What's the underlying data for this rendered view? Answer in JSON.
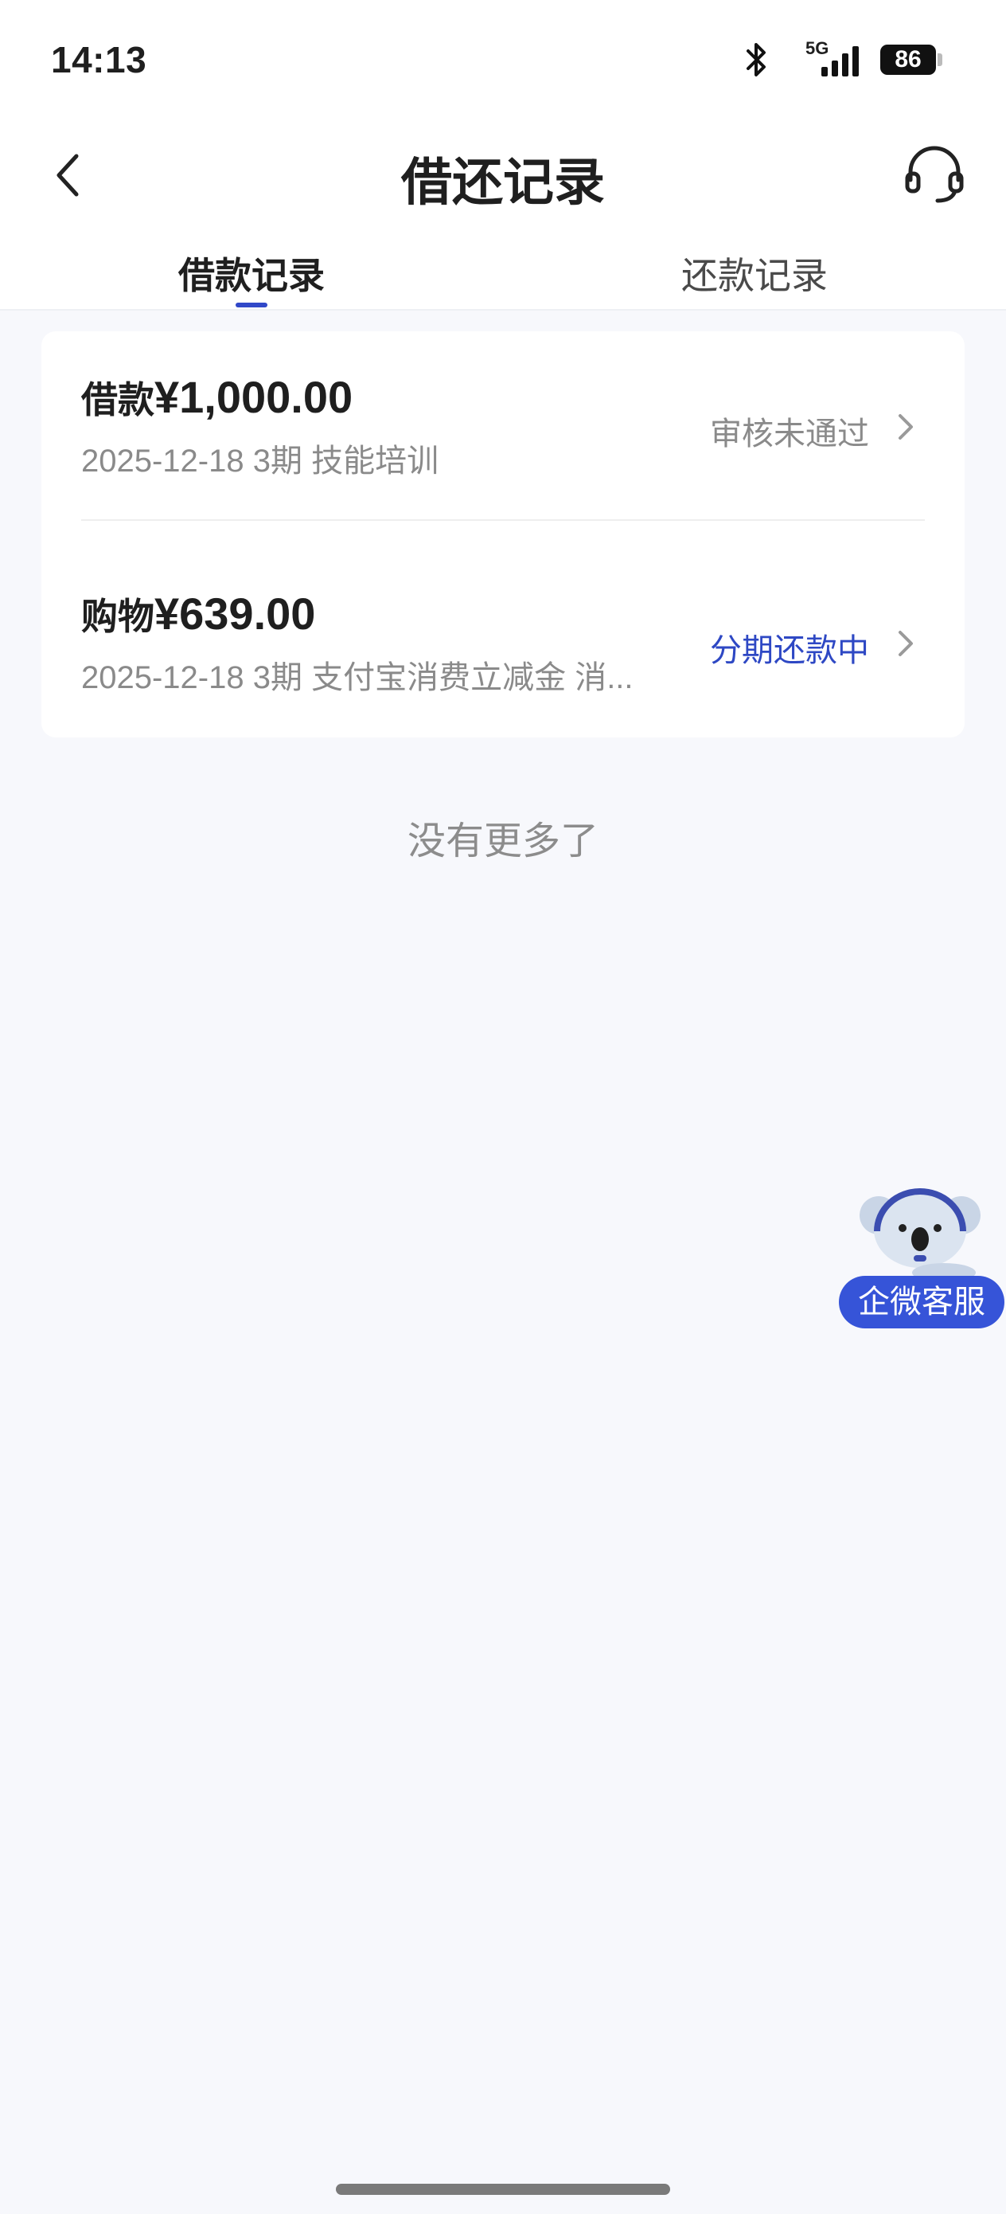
{
  "status_bar": {
    "time": "14:13",
    "network": "5G",
    "battery": "86"
  },
  "nav": {
    "title": "借还记录"
  },
  "tabs": [
    {
      "label": "借款记录",
      "active": true
    },
    {
      "label": "还款记录",
      "active": false
    }
  ],
  "records": [
    {
      "kind": "借款",
      "amount": "¥1,000.00",
      "subtitle": "2025-12-18 3期  技能培训",
      "status": "审核未通过",
      "status_color": "#8a8a8a"
    },
    {
      "kind": "购物",
      "amount": "¥639.00",
      "subtitle": "2025-12-18 3期  支付宝消费立减金 消...",
      "status": "分期还款中",
      "status_color": "#2e48c4"
    }
  ],
  "list_footer": "没有更多了",
  "floating_service": {
    "label": "企微客服",
    "icon": "koala-mascot-icon"
  },
  "colors": {
    "accent": "#3148c8",
    "background": "#f7f8fc",
    "pill": "#3654d8"
  }
}
